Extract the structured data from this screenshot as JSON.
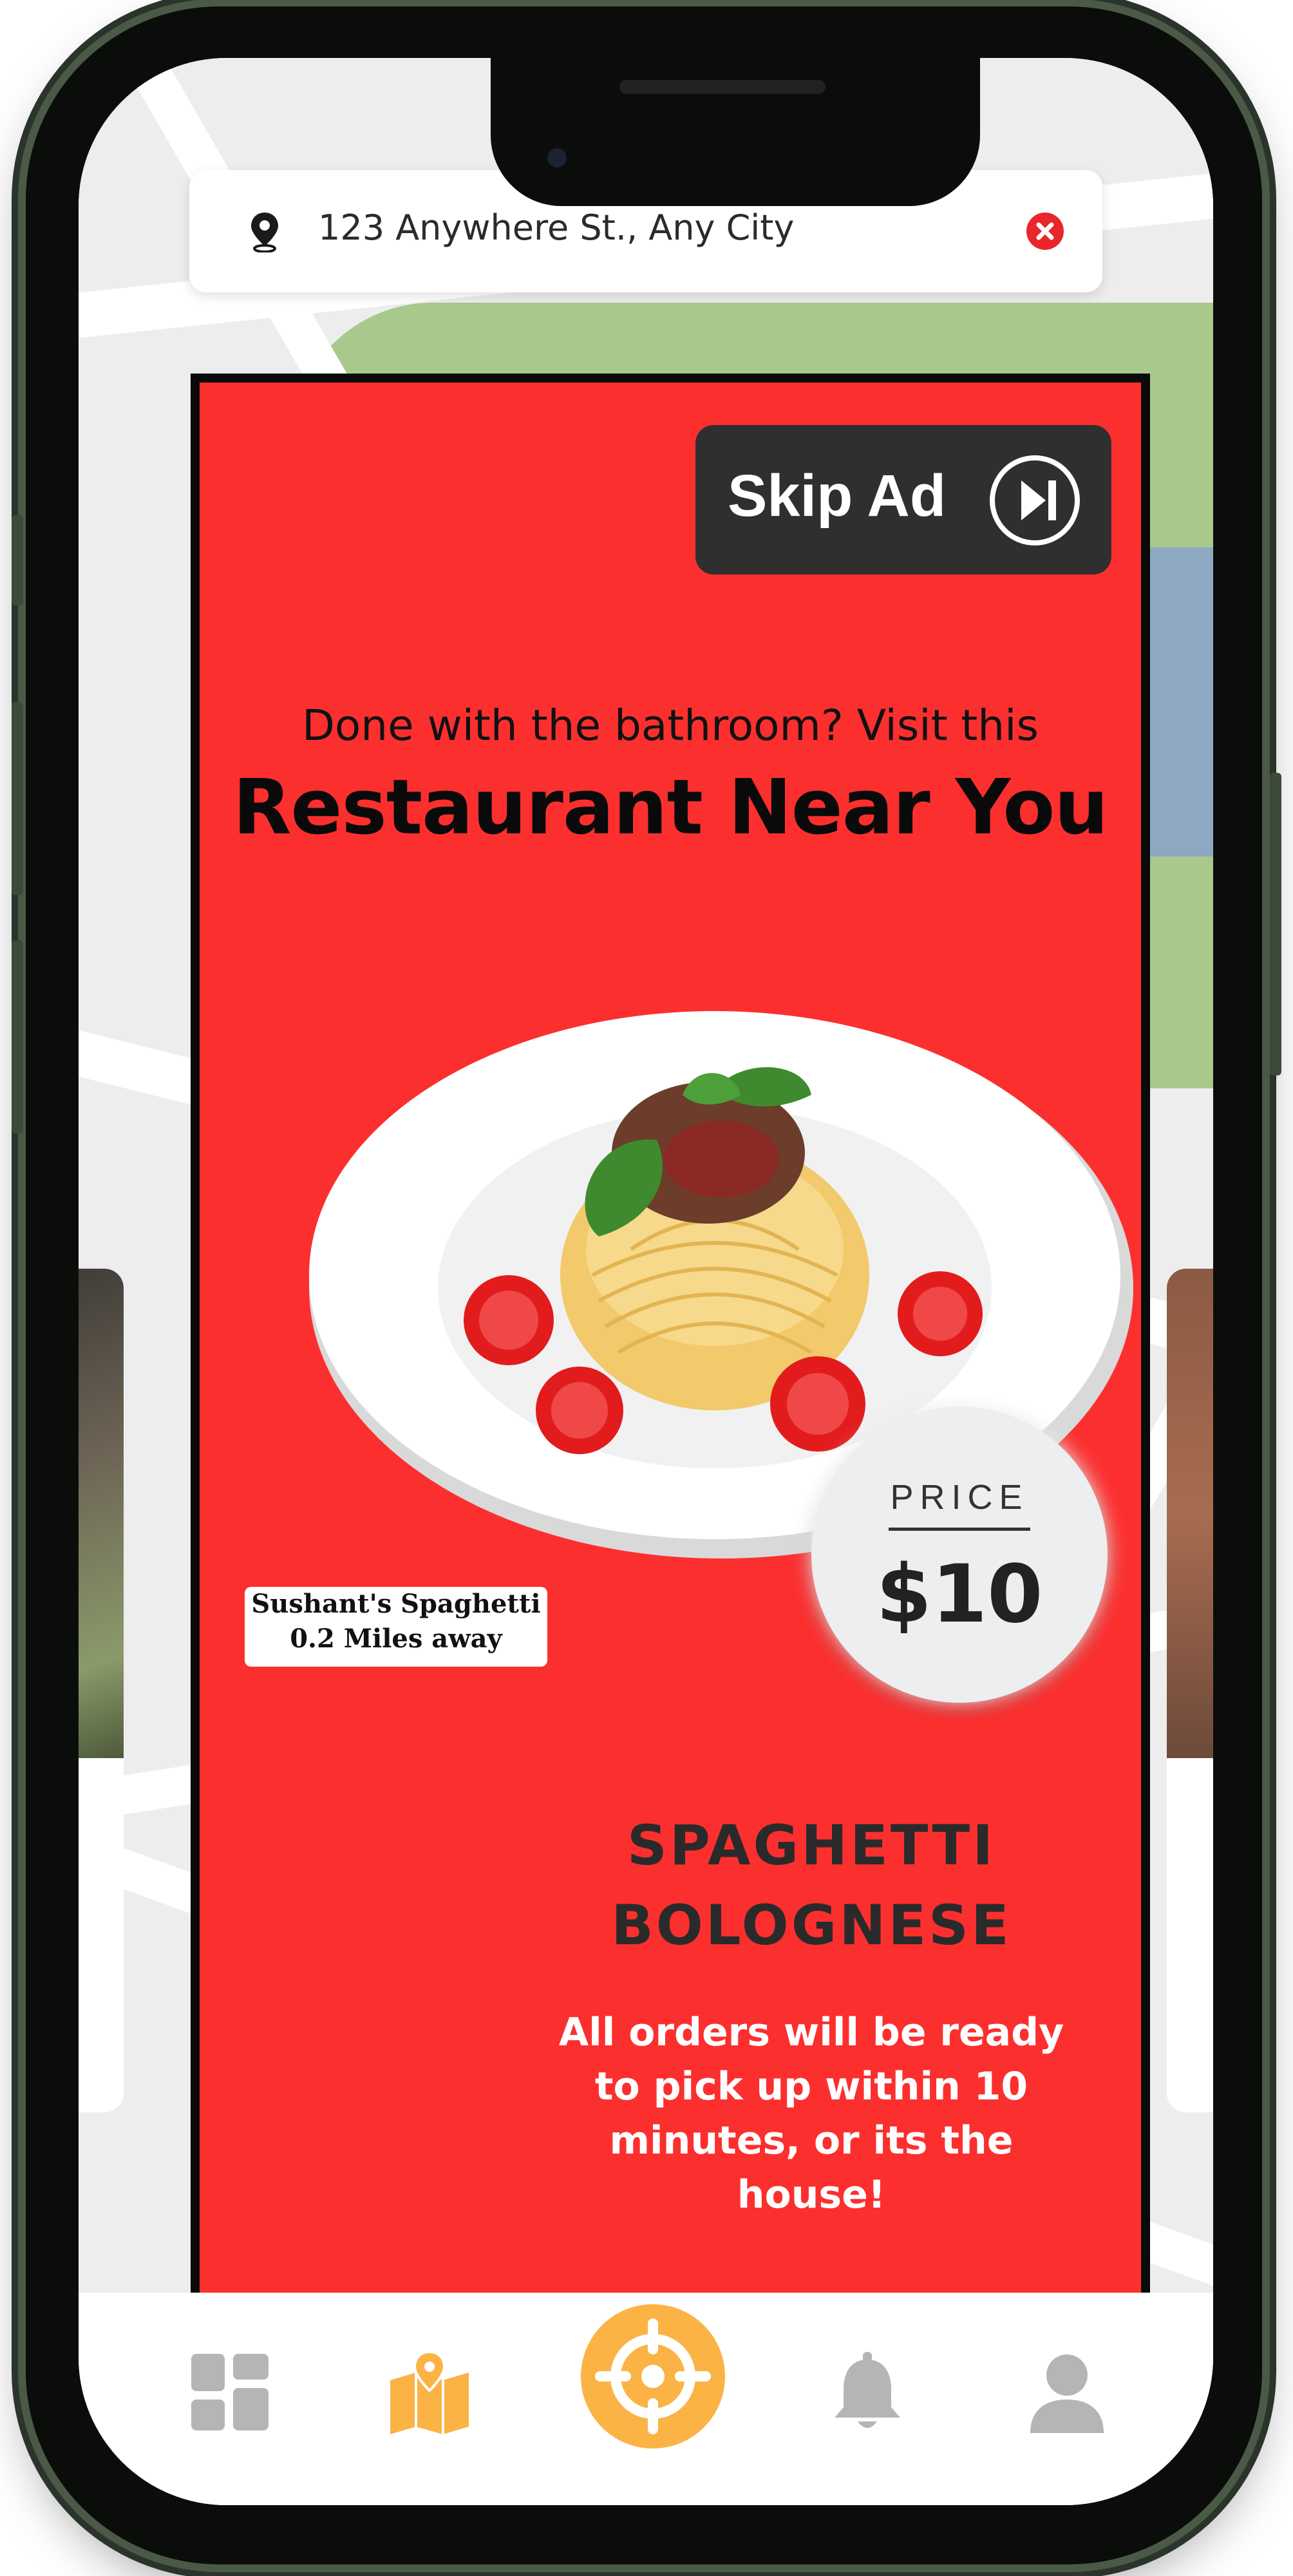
{
  "address_bar": {
    "address": "123 Anywhere St., Any City",
    "pin_icon": "map-pin-icon",
    "clear_icon": "close-circle-icon"
  },
  "ad": {
    "skip_label": "Skip Ad",
    "skip_icon": "skip-next-icon",
    "tagline": "Done with the bathroom? Visit this",
    "title": "Restaurant Near You",
    "restaurant_name": "Sushant's Spaghetti",
    "distance": "0.2 Miles away",
    "price_label": "PRICE",
    "price_value": "$10",
    "dish_line1": "SPAGHETTI",
    "dish_line2": "BOLOGNESE",
    "promo_line1": "All orders will be ready",
    "promo_line2": "to pick up within 10",
    "promo_line3": "minutes, or its the house!"
  },
  "bottom_nav": {
    "items": [
      {
        "icon": "dashboard-grid-icon",
        "active": false
      },
      {
        "icon": "map-icon",
        "active": true
      },
      {
        "icon": "locate-target-icon",
        "active": true
      },
      {
        "icon": "bell-icon",
        "active": false
      },
      {
        "icon": "user-profile-icon",
        "active": false
      }
    ]
  },
  "colors": {
    "ad_background": "#fc2f2f",
    "accent_orange": "#fbb345",
    "nav_inactive": "#b5b5b5",
    "clear_red": "#e8262b",
    "skip_button": "#2f2f2f"
  }
}
